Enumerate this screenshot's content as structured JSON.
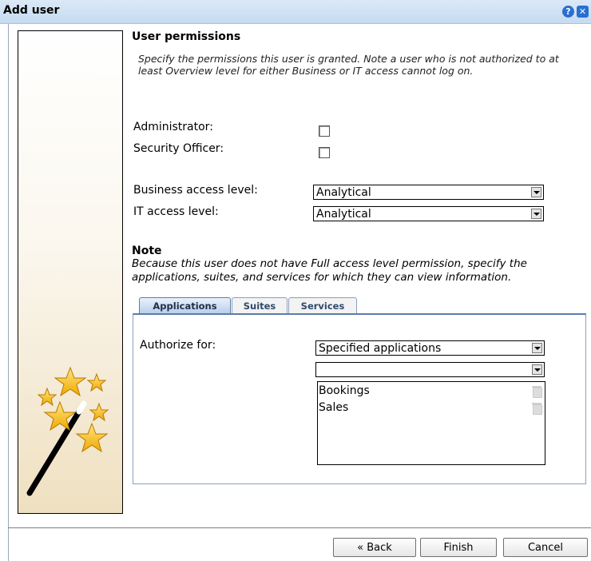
{
  "window": {
    "title": "Add user",
    "help_icon": "help-icon",
    "close_icon": "close-icon"
  },
  "permissions": {
    "heading": "User permissions",
    "description": "Specify the permissions this user is granted. Note a user who is not authorized to at least Overview level for either Business or IT access cannot log on.",
    "administrator_label": "Administrator:",
    "administrator_checked": false,
    "security_officer_label": "Security Officer:",
    "security_officer_checked": false,
    "business_access_label": "Business access level:",
    "business_access_value": "Analytical",
    "it_access_label": "IT access level:",
    "it_access_value": "Analytical"
  },
  "note": {
    "heading": "Note",
    "text": "Because this user does not have Full access level permission, specify the applications, suites, and services for which they can view information."
  },
  "tabs": [
    {
      "label": "Applications",
      "active": true
    },
    {
      "label": "Suites",
      "active": false
    },
    {
      "label": "Services",
      "active": false
    }
  ],
  "authorize": {
    "label": "Authorize for:",
    "value": "Specified applications",
    "secondary_value": "",
    "items": [
      "Bookings",
      "Sales"
    ]
  },
  "buttons": {
    "back": "« Back",
    "finish": "Finish",
    "cancel": "Cancel"
  }
}
